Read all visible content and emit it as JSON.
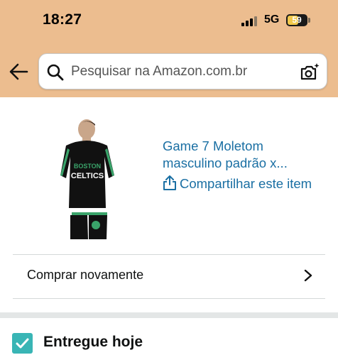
{
  "status_bar": {
    "time": "18:27",
    "network": "5G",
    "battery_level": "59",
    "battery_fraction": 0.59
  },
  "search": {
    "placeholder": "Pesquisar na Amazon.com.br",
    "back_icon": "arrow-left-icon",
    "search_icon": "magnifier-icon",
    "camera_icon": "camera-sparkle-icon"
  },
  "product": {
    "title": "Game 7 Moletom masculino padrão x...",
    "share_label": "Compartilhar este item",
    "image_text": "BOSTON CELTICS"
  },
  "buy_again": {
    "label": "Comprar novamente"
  },
  "delivery": {
    "label": "Entregue hoje",
    "checked": true
  },
  "colors": {
    "header_bg": "#ecbd8f",
    "link": "#1a6fa3",
    "checkbox": "#39b5b5"
  }
}
